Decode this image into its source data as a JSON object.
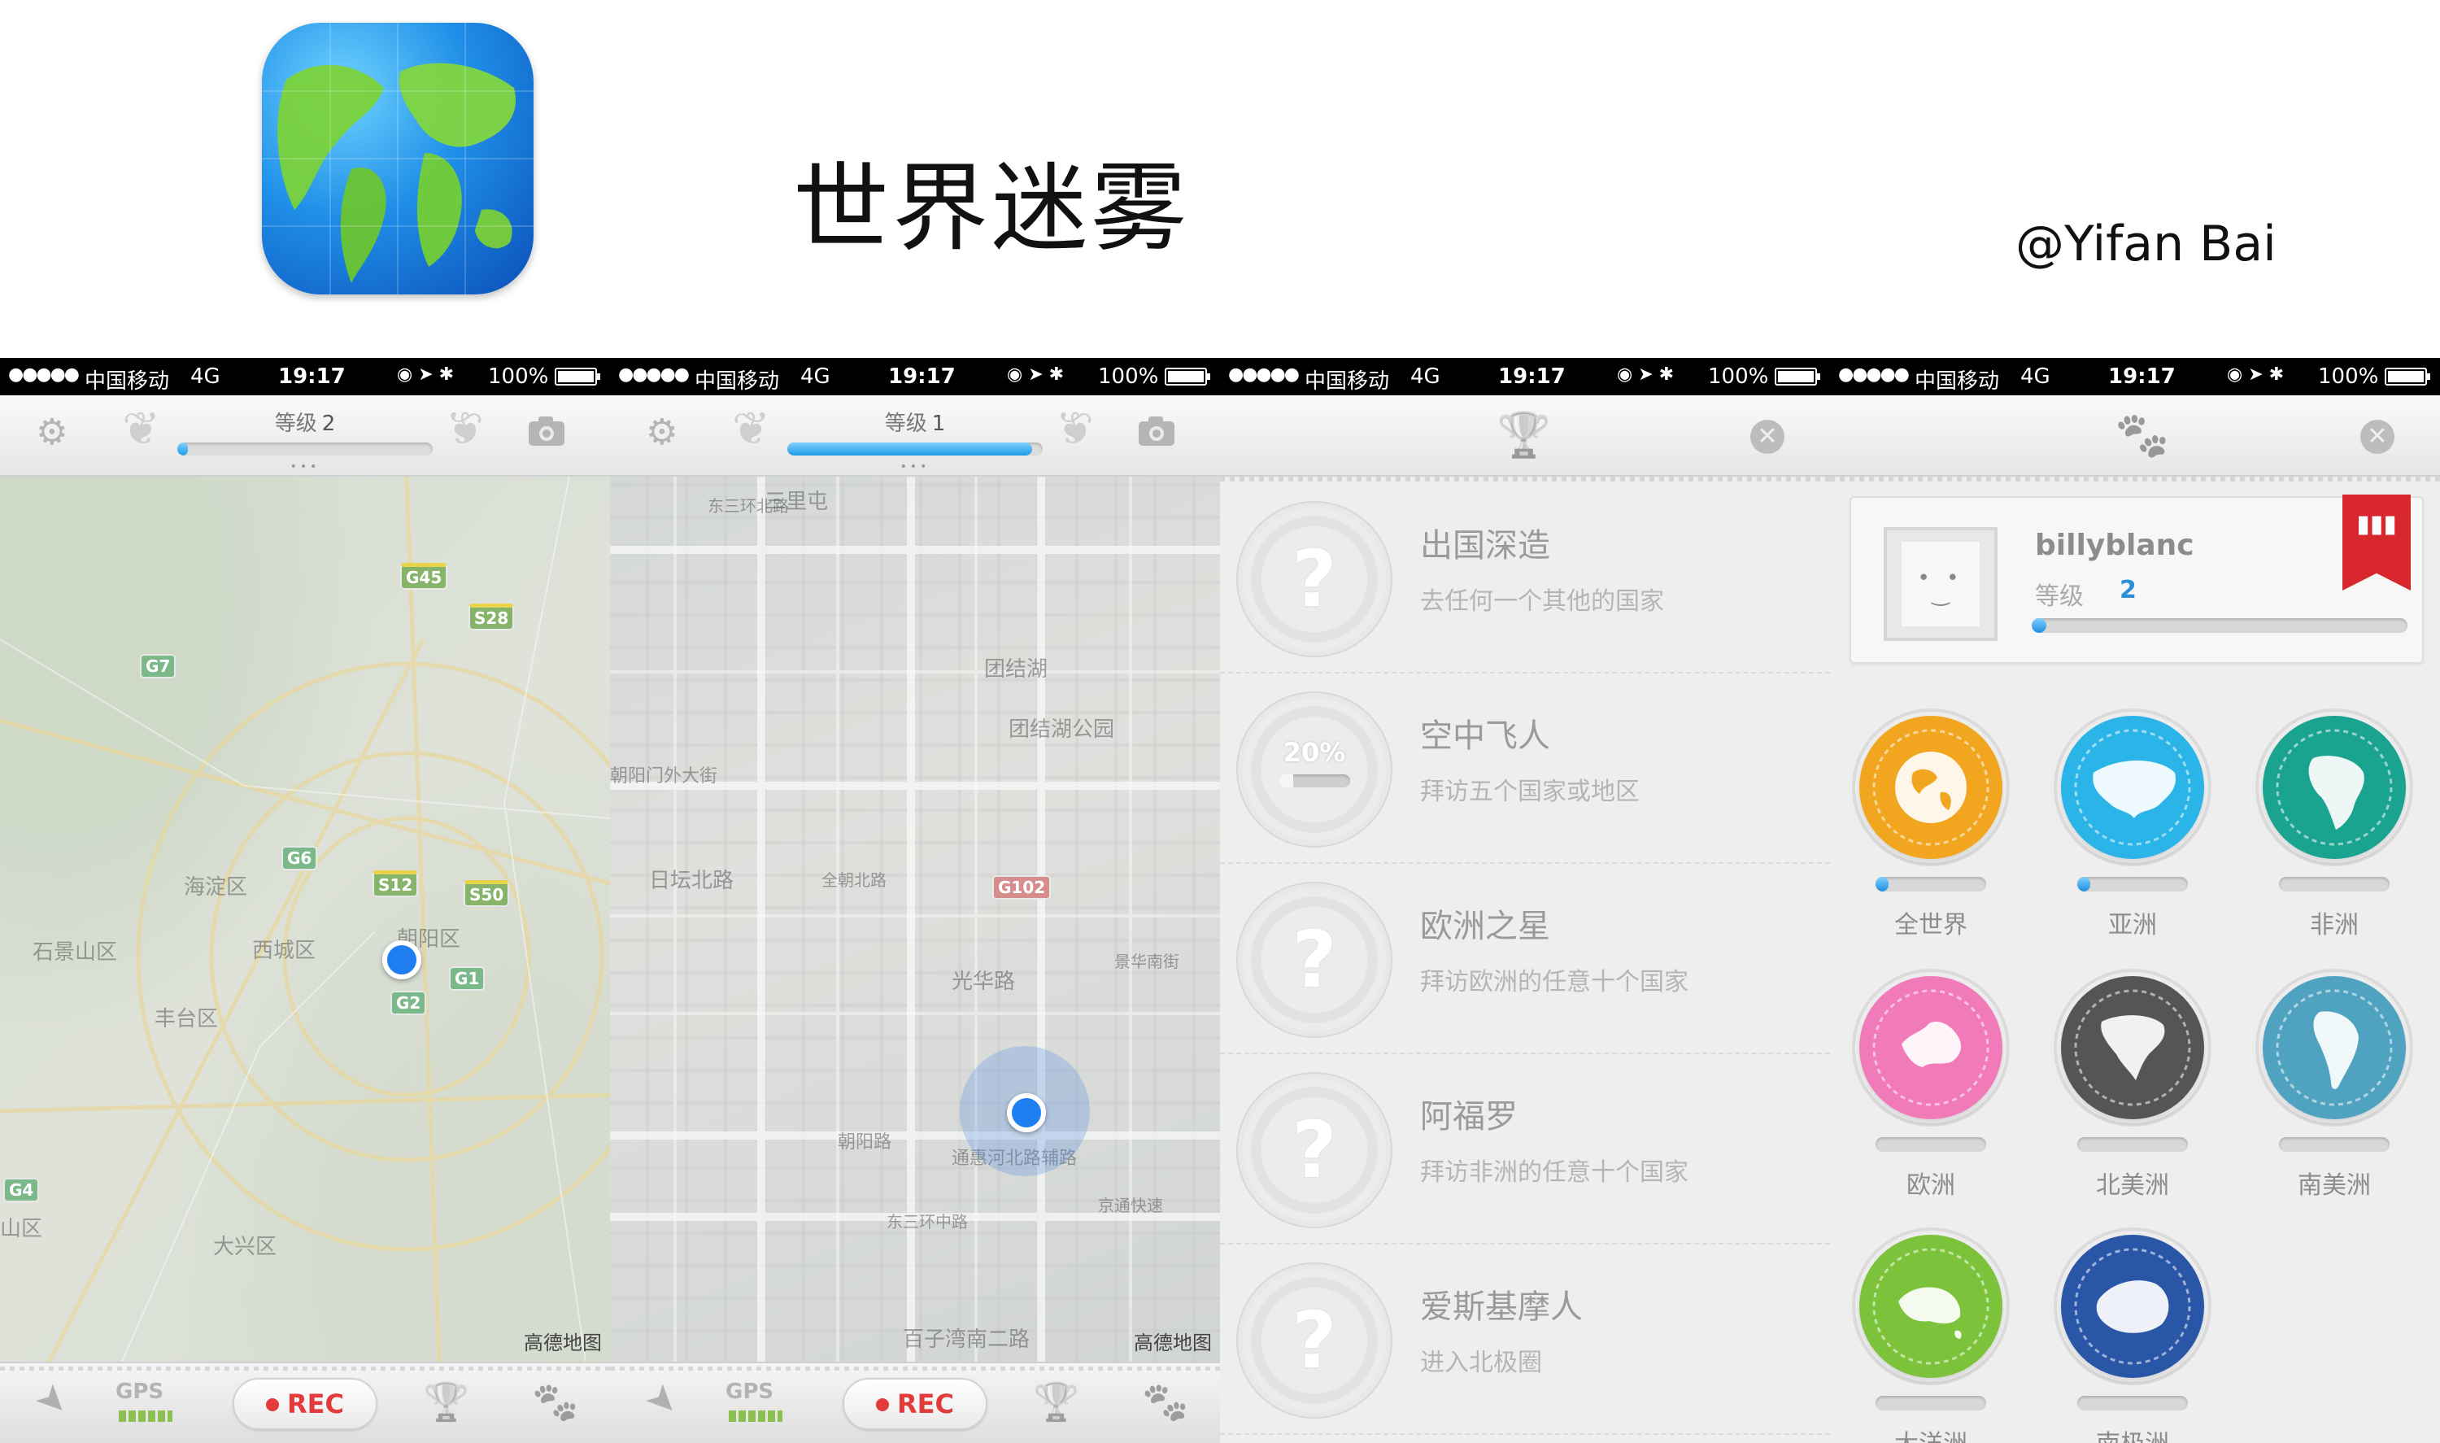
{
  "header": {
    "app_name": "世界迷雾",
    "author": "@Yifan Bai"
  },
  "status_bar": {
    "signal": "●●●●●",
    "carrier": "中国移动",
    "network": "4G",
    "time": "19:17",
    "icons": "◉ ➤ ✱",
    "battery": "100%"
  },
  "screen1": {
    "level_label": "等级",
    "level_value": "2",
    "level_progress": 0.04,
    "page_dots": "•••",
    "map_labels": [
      "海淀区",
      "西城区",
      "朝阳区",
      "石景山区",
      "丰台区",
      "大兴区",
      "山区"
    ],
    "shields": [
      "G45",
      "S28",
      "G7",
      "G6",
      "S12",
      "S50",
      "G1",
      "G2",
      "G4"
    ],
    "attribution": "高德地图",
    "gps_label": "GPS",
    "rec_label": "REC"
  },
  "screen2": {
    "level_label": "等级",
    "level_value": "1",
    "level_progress": 0.96,
    "page_dots": "•••",
    "map_labels": [
      "三里屯",
      "团结湖",
      "团结湖公园",
      "日坛北路",
      "朝阳门外大街",
      "全朝北路",
      "光华路",
      "东三环中路",
      "通惠河北路辅路",
      "百子湾南二路",
      "朝阳路",
      "京通快速",
      "东三环北路",
      "景华南街"
    ],
    "shields": [
      "G102"
    ],
    "attribution": "高德地图",
    "gps_label": "GPS",
    "rec_label": "REC"
  },
  "screen3": {
    "achievements": [
      {
        "title": "出国深造",
        "desc": "去任何一个其他的国家",
        "badge": "?",
        "progress": null
      },
      {
        "title": "空中飞人",
        "desc": "拜访五个国家或地区",
        "badge": "20%",
        "progress": 0.2
      },
      {
        "title": "欧洲之星",
        "desc": "拜访欧洲的任意十个国家",
        "badge": "?",
        "progress": null
      },
      {
        "title": "阿福罗",
        "desc": "拜访非洲的任意十个国家",
        "badge": "?",
        "progress": null
      },
      {
        "title": "爱斯基摩人",
        "desc": "进入北极圈",
        "badge": "?",
        "progress": null
      }
    ]
  },
  "screen4": {
    "username": "billyblanc",
    "level_label": "等级",
    "level_value": "2",
    "level_progress": 0.04,
    "continents": [
      {
        "label": "全世界",
        "color": "#f2a61f",
        "progress": 0.1
      },
      {
        "label": "亚洲",
        "color": "#2bb4e8",
        "progress": 0.1
      },
      {
        "label": "非洲",
        "color": "#1aa38f",
        "progress": 0
      },
      {
        "label": "欧洲",
        "color": "#f07bb8",
        "progress": 0
      },
      {
        "label": "北美洲",
        "color": "#555555",
        "progress": 0
      },
      {
        "label": "南美洲",
        "color": "#4fa3c0",
        "progress": 0
      },
      {
        "label": "大洋洲",
        "color": "#7cc23a",
        "progress": 0
      },
      {
        "label": "南极洲",
        "color": "#2a56a8",
        "progress": 0
      }
    ]
  },
  "icons": {
    "settings": "⚙",
    "camera": "📷",
    "laurel": "❦",
    "location_arrow": "➤",
    "trophy": "🏆",
    "paw": "🐾",
    "close": "✕",
    "rank": "▮▮▮"
  }
}
